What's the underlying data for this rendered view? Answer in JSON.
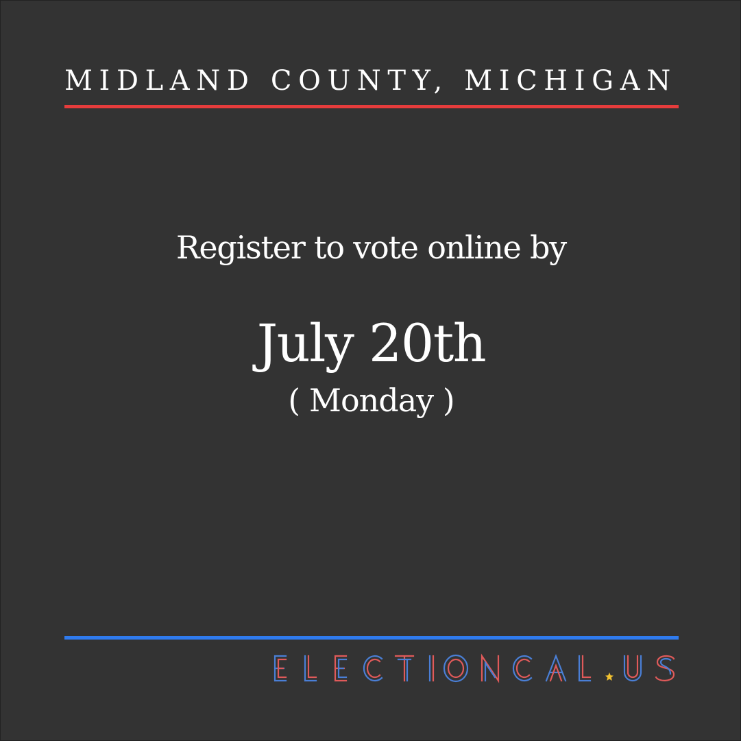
{
  "header": {
    "county": "MIDLAND COUNTY, MICHIGAN"
  },
  "message": {
    "intro": "Register to vote online by",
    "date": "July 20th",
    "weekday": "( Monday )"
  },
  "brand": {
    "logo_text": "ELECTIONCAL.US",
    "colors": {
      "background": "#333333",
      "red": "#e63c3c",
      "blue": "#2f7bef",
      "star": "#f2c230"
    }
  }
}
